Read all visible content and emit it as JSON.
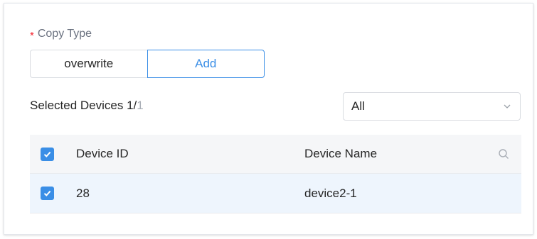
{
  "form": {
    "copy_type_label": "Copy Type",
    "required_mark": "*",
    "options": [
      {
        "label": "overwrite",
        "selected": false
      },
      {
        "label": "Add",
        "selected": true
      }
    ]
  },
  "selection": {
    "label": "Selected Devices 1/",
    "total": "1"
  },
  "filter": {
    "value": "All",
    "icon": "chevron-down-icon"
  },
  "table": {
    "columns": {
      "device_id": "Device ID",
      "device_name": "Device Name"
    },
    "header_checked": true,
    "rows": [
      {
        "checked": true,
        "device_id": "28",
        "device_name": "device2-1"
      }
    ]
  },
  "colors": {
    "accent": "#3a8ee6",
    "required": "#f5222d",
    "row_highlight": "#eef5fd",
    "header_bg": "#f5f6f8"
  }
}
